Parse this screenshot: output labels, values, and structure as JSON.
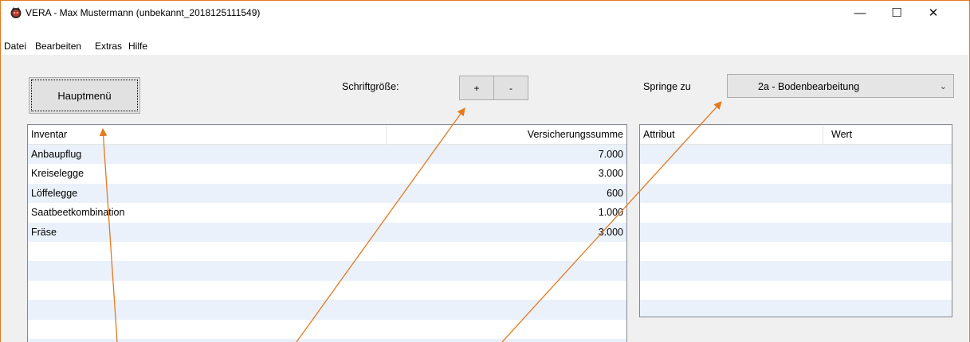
{
  "window": {
    "title": "VERA - Max Mustermann (unbekannt_2018125111549)",
    "accent_color": "#e5791f",
    "controls": {
      "minimize": "—",
      "maximize": "☐",
      "close": "✕"
    }
  },
  "menu": [
    "Datei",
    "Bearbeiten",
    "Extras",
    "Hilfe"
  ],
  "toolbar": {
    "main_menu_label": "Hauptmenü",
    "font_size_label": "Schriftgröße:",
    "plus_label": "+",
    "minus_label": "-",
    "jump_label": "Springe zu",
    "jump_value": "2a - Bodenbearbeitung"
  },
  "inventory_table": {
    "columns": [
      "Inventar",
      "Versicherungssumme"
    ],
    "rows": [
      {
        "name": "Anbaupflug",
        "value": "7.000"
      },
      {
        "name": "Kreiselegge",
        "value": "3.000"
      },
      {
        "name": "Löffelegge",
        "value": "600"
      },
      {
        "name": "Saatbeetkombination",
        "value": "1.000"
      },
      {
        "name": "Fräse",
        "value": "3.000"
      },
      {
        "name": "",
        "value": ""
      },
      {
        "name": "",
        "value": ""
      },
      {
        "name": "",
        "value": ""
      },
      {
        "name": "",
        "value": ""
      },
      {
        "name": "",
        "value": ""
      },
      {
        "name": "",
        "value": ""
      }
    ]
  },
  "attribute_table": {
    "columns": [
      "Attribut",
      "Wert"
    ],
    "rows": [
      "",
      "",
      "",
      "",
      "",
      "",
      "",
      "",
      ""
    ]
  },
  "annotation_color": "#e5791f"
}
